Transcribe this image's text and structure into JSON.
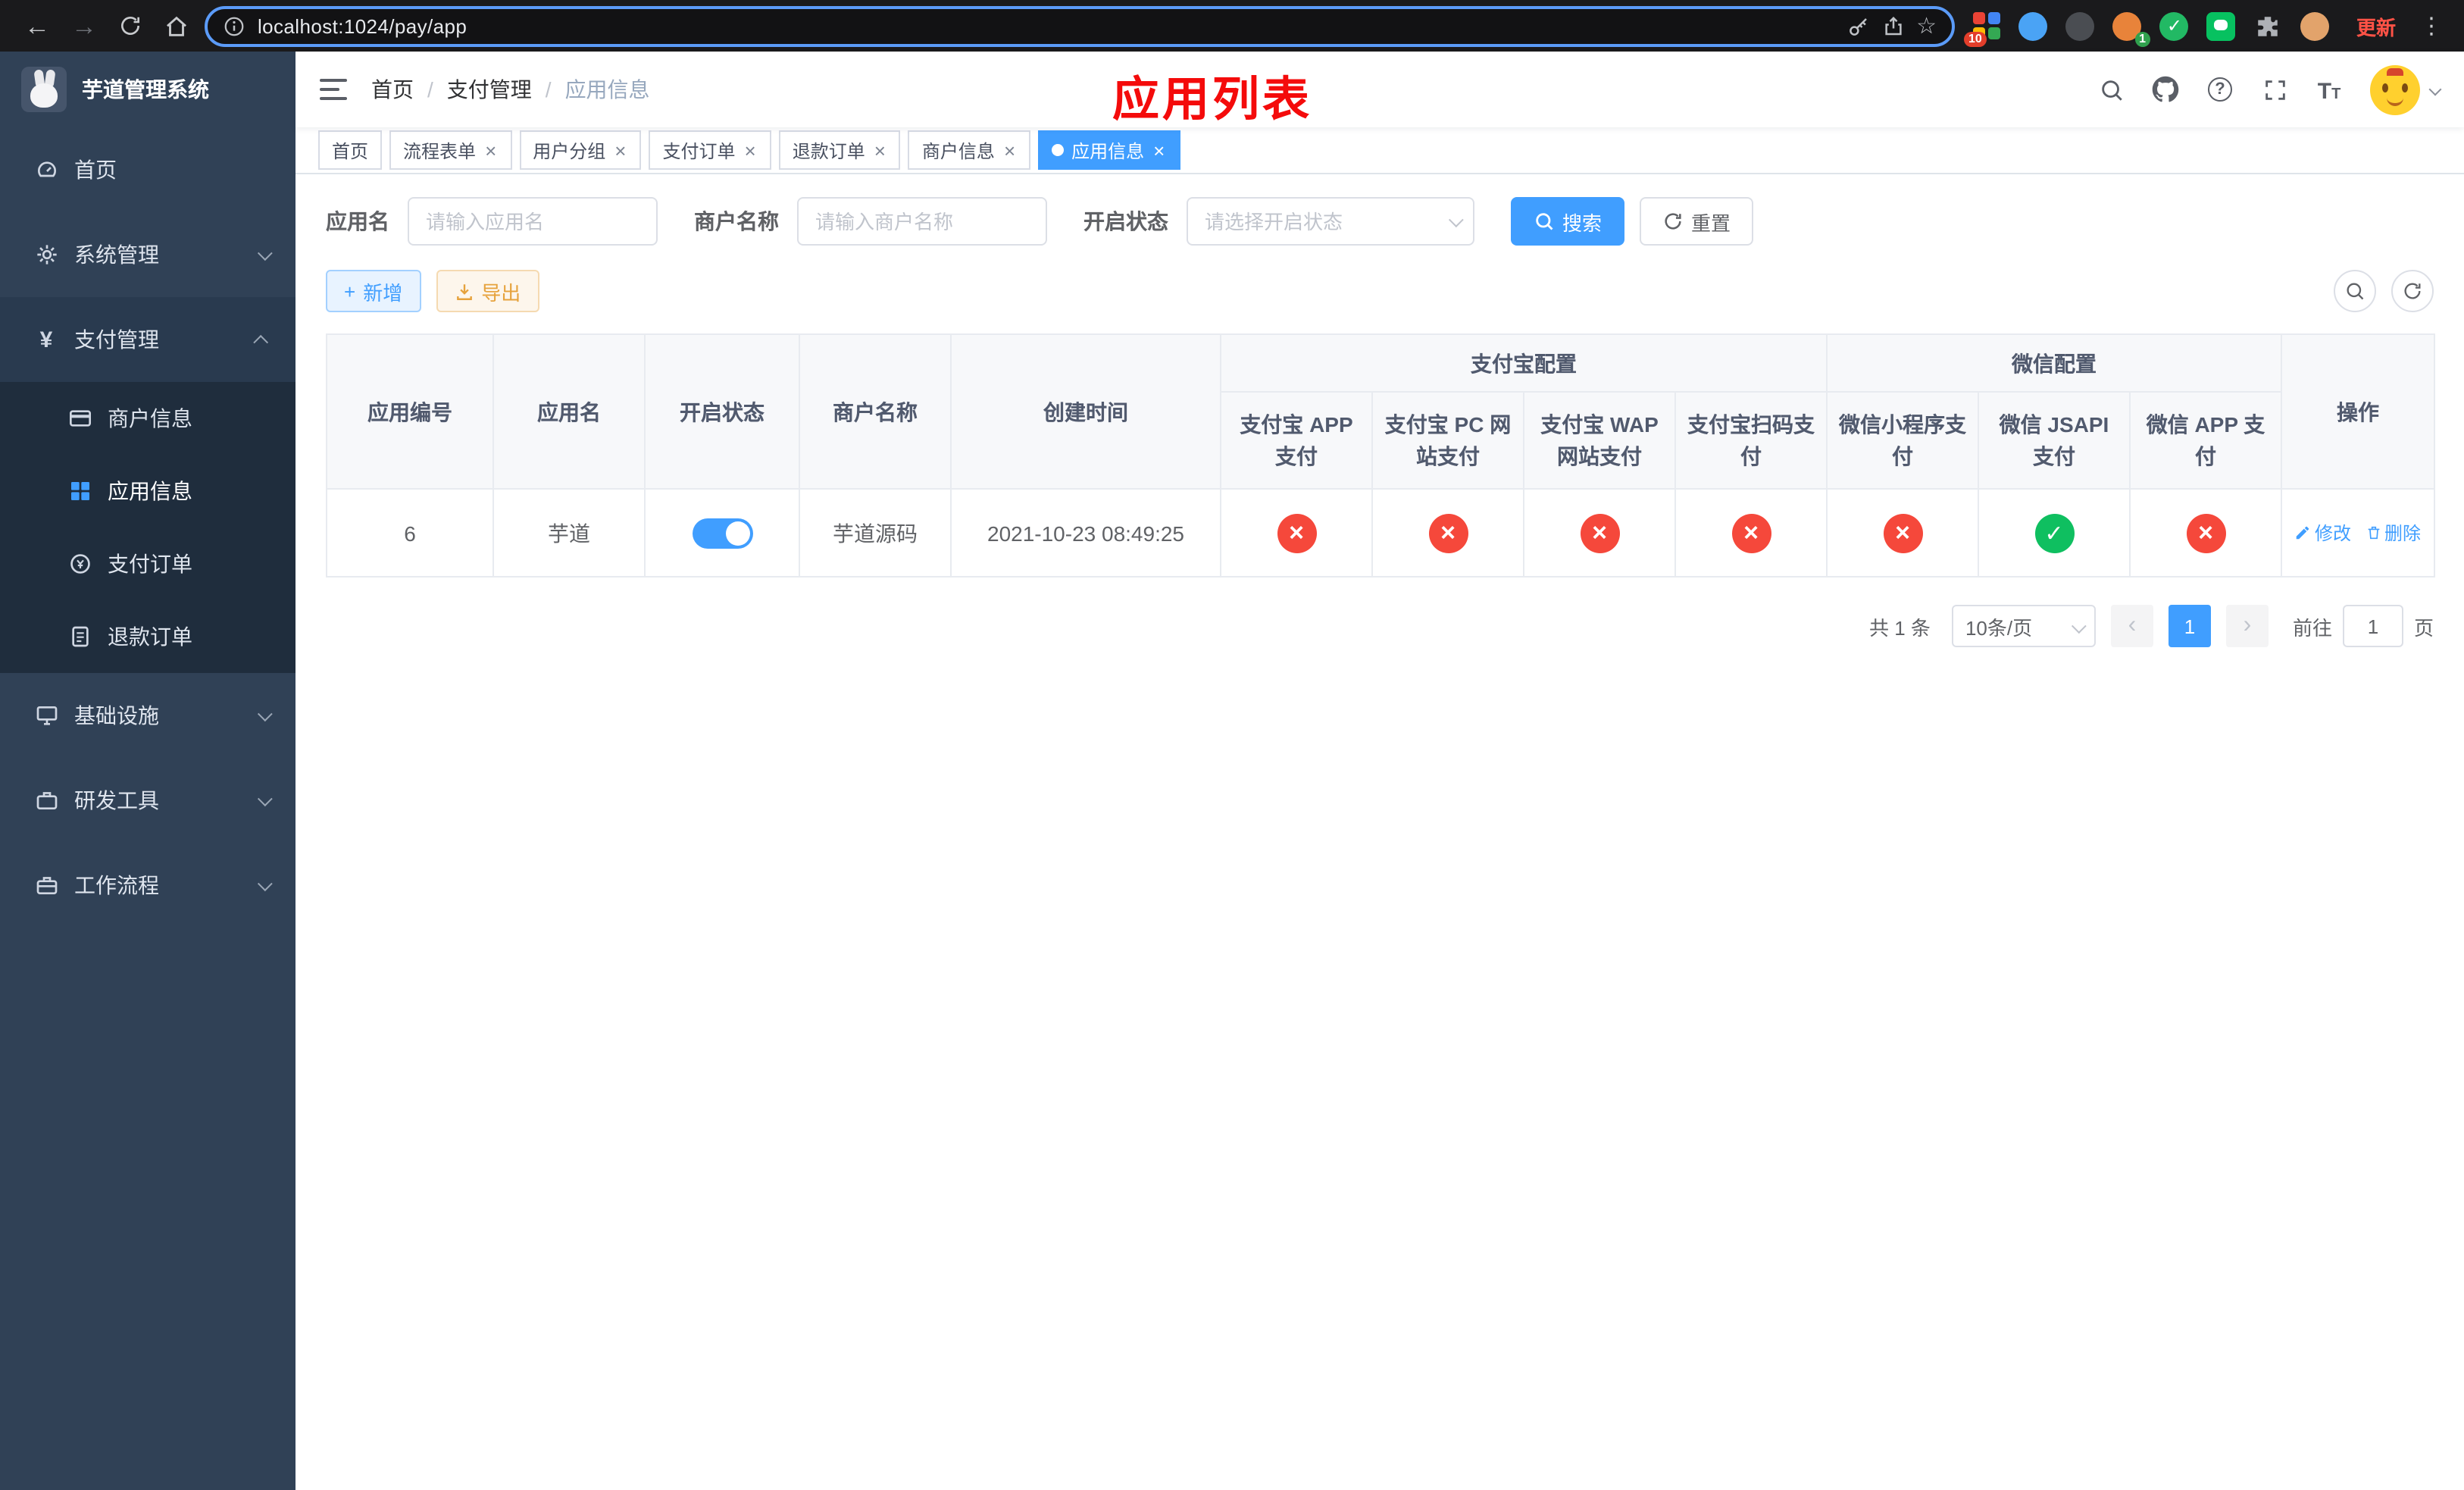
{
  "icons": {
    "back": "←",
    "forward": "→",
    "star": "☆",
    "menu_dots": "⋮",
    "close": "×",
    "yen": "¥",
    "help": "?",
    "slash": "/",
    "plus": "+",
    "check": "✓",
    "letter_t_big": "T",
    "letter_t_small": "T",
    "prev": "‹",
    "next": "›"
  },
  "browser": {
    "url": "localhost:1024/pay/app",
    "update_label": "更新",
    "ext_badge_grid": "10",
    "ext_badge_avatar": "1"
  },
  "sidebar": {
    "title": "芋道管理系统",
    "items": [
      {
        "label": "首页"
      },
      {
        "label": "系统管理"
      },
      {
        "label": "支付管理"
      },
      {
        "label": "商户信息"
      },
      {
        "label": "应用信息"
      },
      {
        "label": "支付订单"
      },
      {
        "label": "退款订单"
      },
      {
        "label": "基础设施"
      },
      {
        "label": "研发工具"
      },
      {
        "label": "工作流程"
      }
    ]
  },
  "header": {
    "breadcrumb": [
      "首页",
      "支付管理",
      "应用信息"
    ],
    "annotation": "应用列表"
  },
  "tabs": [
    {
      "label": "首页"
    },
    {
      "label": "流程表单"
    },
    {
      "label": "用户分组"
    },
    {
      "label": "支付订单"
    },
    {
      "label": "退款订单"
    },
    {
      "label": "商户信息"
    },
    {
      "label": "应用信息"
    }
  ],
  "filters": {
    "app_name_label": "应用名",
    "app_name_placeholder": "请输入应用名",
    "merchant_label": "商户名称",
    "merchant_placeholder": "请输入商户名称",
    "status_label": "开启状态",
    "status_placeholder": "请选择开启状态",
    "search_label": "搜索",
    "reset_label": "重置"
  },
  "toolbar": {
    "add_label": "新增",
    "export_label": "导出"
  },
  "table": {
    "headers": {
      "app_id": "应用编号",
      "app_name": "应用名",
      "status": "开启状态",
      "merchant": "商户名称",
      "created": "创建时间",
      "alipay_group": "支付宝配置",
      "wechat_group": "微信配置",
      "alipay_app": "支付宝 APP 支付",
      "alipay_pc": "支付宝 PC 网站支付",
      "alipay_wap": "支付宝 WAP 网站支付",
      "alipay_qr": "支付宝扫码支付",
      "wx_mini": "微信小程序支付",
      "wx_jsapi": "微信 JSAPI 支付",
      "wx_app": "微信 APP 支付",
      "actions": "操作"
    },
    "row": {
      "app_id": "6",
      "app_name": "芋道",
      "status": "on",
      "merchant": "芋道源码",
      "created": "2021-10-23 08:49:25",
      "alipay_app": "fail",
      "alipay_pc": "fail",
      "alipay_wap": "fail",
      "alipay_qr": "fail",
      "wx_mini": "fail",
      "wx_jsapi": "success",
      "wx_app": "fail",
      "edit_label": "修改",
      "delete_label": "删除"
    }
  },
  "pagination": {
    "total": "共 1 条",
    "page_size": "10条/页",
    "page": "1",
    "goto_prefix": "前往",
    "goto_value": "1",
    "goto_suffix": "页"
  },
  "colors": {
    "accent": "#409eff",
    "danger": "#f5483b",
    "success": "#0fbf60",
    "sidebar_bg": "#304156",
    "annotation_red": "#f40b0b"
  }
}
